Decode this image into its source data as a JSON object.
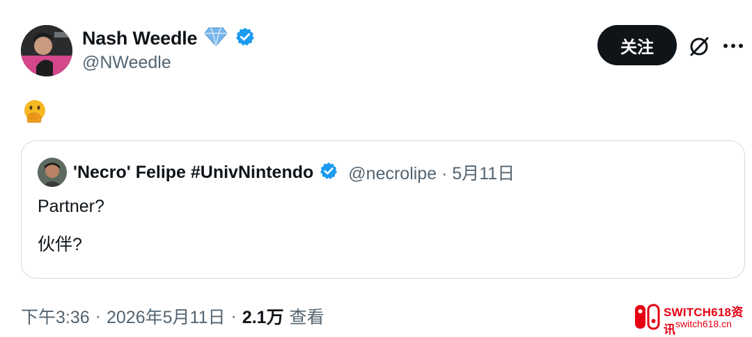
{
  "author": {
    "name": "Nash Weedle",
    "handle": "@NWeedle",
    "badges": [
      "diamond-icon",
      "verified-badge-icon"
    ]
  },
  "actions": {
    "follow_label": "关注",
    "grok_icon": "grok-icon",
    "more_icon": "more-icon"
  },
  "tweet": {
    "emoji": "face-with-hand-over-mouth"
  },
  "quote": {
    "name": "'Necro' Felipe #UnivNintendo",
    "handle": "@necrolipe",
    "separator": "·",
    "date": "5月11日",
    "text_line1": "Partner?",
    "text_line2": "伙伴?"
  },
  "footer": {
    "time": "下午3:36",
    "dot1": "·",
    "date": "2026年5月11日",
    "dot2": "·",
    "views": "2.1万",
    "views_label": "查看"
  },
  "watermark": {
    "title": "SWITCH618资讯",
    "sub": "switch618.cn"
  },
  "colors": {
    "accent_blue": "#1d9bf0",
    "text": "#0f1419",
    "muted": "#536471",
    "border": "#cfd9de",
    "brand_red": "#e60012"
  }
}
